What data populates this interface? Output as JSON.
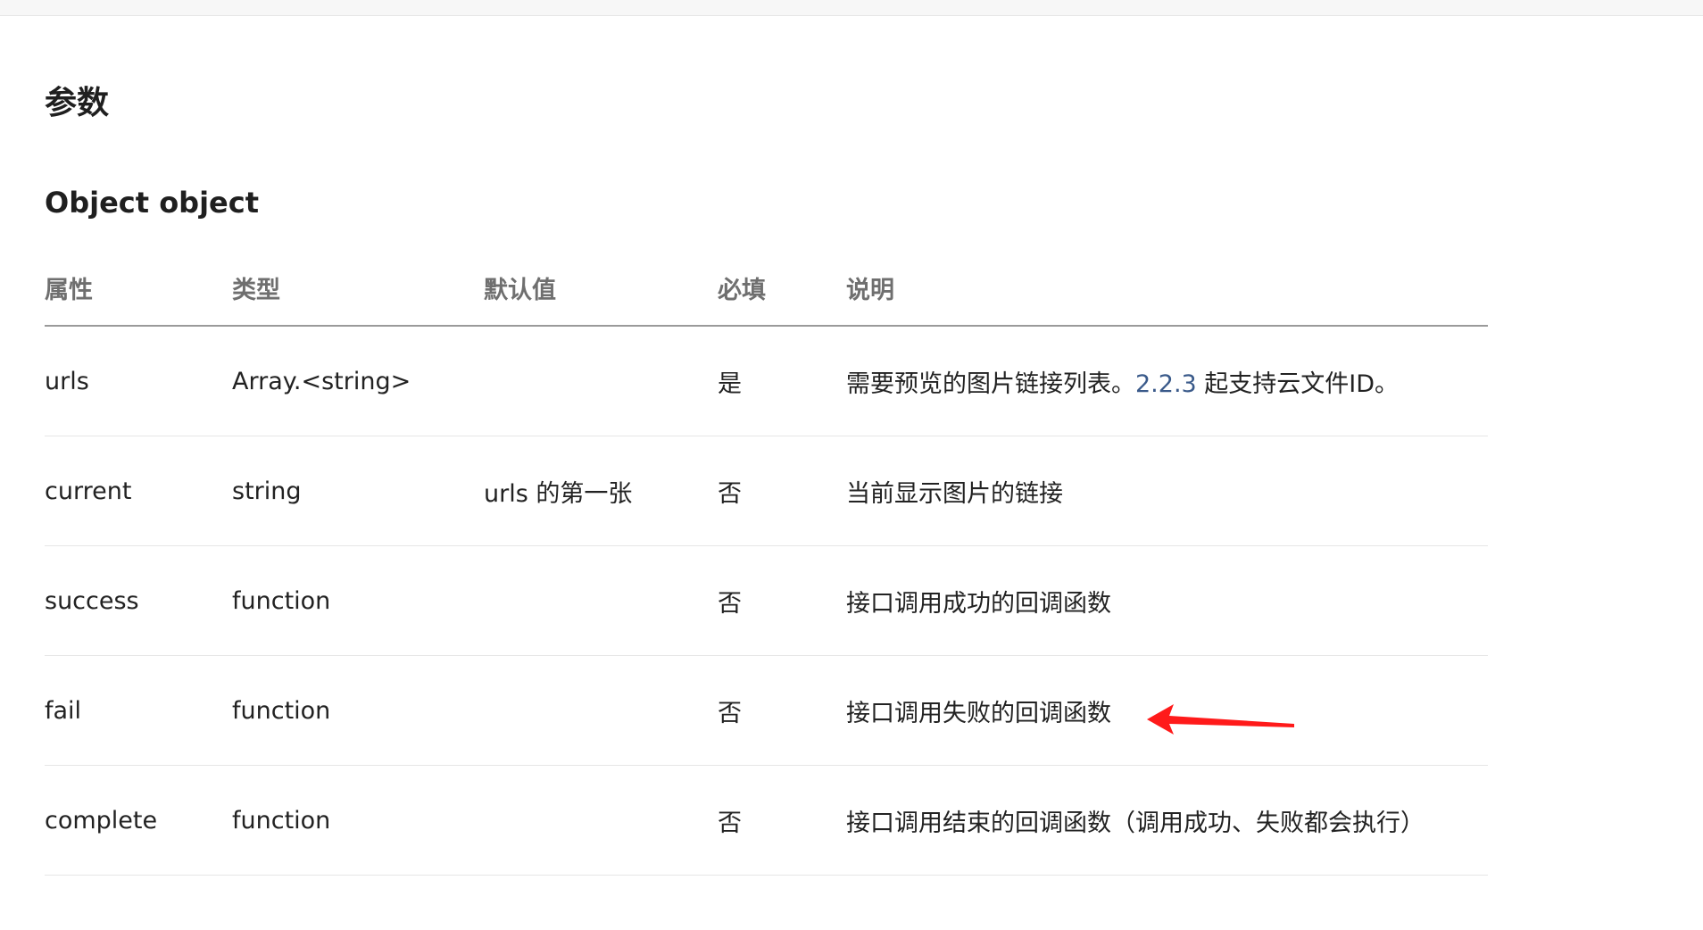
{
  "section_title": "参数",
  "object_title": "Object object",
  "table": {
    "headers": [
      "属性",
      "类型",
      "默认值",
      "必填",
      "说明"
    ],
    "rows": [
      {
        "name": "urls",
        "type": "Array.<string>",
        "default": "",
        "required": "是",
        "desc_before": "需要预览的图片链接列表。",
        "desc_link": "2.2.3",
        "desc_after": " 起支持云文件ID。"
      },
      {
        "name": "current",
        "type": "string",
        "default": "urls 的第一张",
        "required": "否",
        "desc_before": "当前显示图片的链接",
        "desc_link": "",
        "desc_after": ""
      },
      {
        "name": "success",
        "type": "function",
        "default": "",
        "required": "否",
        "desc_before": "接口调用成功的回调函数",
        "desc_link": "",
        "desc_after": ""
      },
      {
        "name": "fail",
        "type": "function",
        "default": "",
        "required": "否",
        "desc_before": "接口调用失败的回调函数",
        "desc_link": "",
        "desc_after": ""
      },
      {
        "name": "complete",
        "type": "function",
        "default": "",
        "required": "否",
        "desc_before": "接口调用结束的回调函数（调用成功、失败都会执行）",
        "desc_link": "",
        "desc_after": ""
      }
    ]
  },
  "annotation": {
    "icon": "red-arrow-icon",
    "color": "#ff1a1a",
    "points_to_row": 3
  },
  "colors": {
    "link": "#3a5a8a",
    "header_text": "#6f6f6f",
    "header_border": "#9a9a9a",
    "row_border": "#e6e6e6"
  }
}
